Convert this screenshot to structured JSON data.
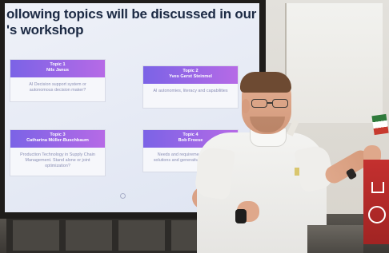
{
  "slide": {
    "title_line1": "ollowing topics will be discussed in our",
    "title_line2": "'s workshop",
    "topics": [
      {
        "number": "Topic 1",
        "presenter": "Nils Janus",
        "description": "AI Decision support system or autonomous decision maker?"
      },
      {
        "number": "Topic 2",
        "presenter": "Yves Gerst Steinmel",
        "description": "AI autonomies, literacy and capabilities"
      },
      {
        "number": "Topic 3",
        "presenter": "Catharina Müller-Buschbaum",
        "description": "Production Technology in Supply Chain Management. Stand alone or joint optimization?"
      },
      {
        "number": "Topic 4",
        "presenter": "Bob Froese",
        "description": "Needs and requirements for digital solutions and generative (humanistic)?"
      }
    ],
    "colors": {
      "header_gradient_start": "#7b63e6",
      "header_gradient_end": "#b66ae6",
      "title_color": "#1c2a44",
      "body_text_color": "#8a8fb5"
    }
  }
}
